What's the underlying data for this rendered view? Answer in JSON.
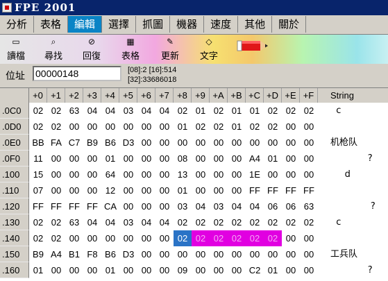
{
  "window": {
    "title": "FPE  2001"
  },
  "menu": [
    {
      "label": "分析",
      "active": false
    },
    {
      "label": "表格",
      "active": false
    },
    {
      "label": "編輯",
      "active": true
    },
    {
      "label": "選擇",
      "active": false
    },
    {
      "label": "抓圖",
      "active": false
    },
    {
      "label": "機器",
      "active": false
    },
    {
      "label": "速度",
      "active": false
    },
    {
      "label": "其他",
      "active": false
    },
    {
      "label": "關於",
      "active": false
    }
  ],
  "toolbar": {
    "buttons": [
      {
        "label": "讀檔",
        "icon": "open-folder-icon"
      },
      {
        "label": "尋找",
        "icon": "find-icon"
      },
      {
        "label": "回復",
        "icon": "undo-icon"
      },
      {
        "label": "表格",
        "icon": "table-icon"
      },
      {
        "label": "更新",
        "icon": "refresh-icon"
      },
      {
        "label": "文字",
        "icon": "text-icon"
      }
    ],
    "graphic": "pencil-icon"
  },
  "address": {
    "label": "位址",
    "value": "00000148",
    "info_line1": "[08]:2  [16]:514",
    "info_line2": "[32]:33686018"
  },
  "hex_grid": {
    "columns": [
      "+0",
      "+1",
      "+2",
      "+3",
      "+4",
      "+5",
      "+6",
      "+7",
      "+8",
      "+9",
      "+A",
      "+B",
      "+C",
      "+D",
      "+E",
      "+F"
    ],
    "string_header": "String",
    "rows": [
      {
        "addr": ".0C0",
        "bytes": [
          "02",
          "02",
          "63",
          "04",
          "04",
          "03",
          "04",
          "04",
          "02",
          "01",
          "02",
          "01",
          "01",
          "02",
          "02",
          "02"
        ],
        "text": "  c"
      },
      {
        "addr": ".0D0",
        "bytes": [
          "02",
          "02",
          "00",
          "00",
          "00",
          "00",
          "00",
          "00",
          "01",
          "02",
          "02",
          "01",
          "02",
          "02",
          "00",
          "00"
        ],
        "text": ""
      },
      {
        "addr": ".0E0",
        "bytes": [
          "BB",
          "FA",
          "C7",
          "B9",
          "B6",
          "D3",
          "00",
          "00",
          "00",
          "00",
          "00",
          "00",
          "00",
          "00",
          "00",
          "00"
        ],
        "text": "机枪队"
      },
      {
        "addr": ".0F0",
        "bytes": [
          "11",
          "00",
          "00",
          "00",
          "01",
          "00",
          "00",
          "00",
          "08",
          "00",
          "00",
          "00",
          "A4",
          "01",
          "00",
          "00"
        ],
        "text": "             ?"
      },
      {
        "addr": ".100",
        "bytes": [
          "15",
          "00",
          "00",
          "00",
          "64",
          "00",
          "00",
          "00",
          "13",
          "00",
          "00",
          "00",
          "1E",
          "00",
          "00",
          "00"
        ],
        "text": "     d"
      },
      {
        "addr": ".110",
        "bytes": [
          "07",
          "00",
          "00",
          "00",
          "12",
          "00",
          "00",
          "00",
          "01",
          "00",
          "00",
          "00",
          "FF",
          "FF",
          "FF",
          "FF"
        ],
        "text": ""
      },
      {
        "addr": ".120",
        "bytes": [
          "FF",
          "FF",
          "FF",
          "FF",
          "CA",
          "00",
          "00",
          "00",
          "03",
          "04",
          "03",
          "04",
          "04",
          "06",
          "06",
          "63"
        ],
        "text": "              ?"
      },
      {
        "addr": ".130",
        "bytes": [
          "02",
          "02",
          "63",
          "04",
          "04",
          "03",
          "04",
          "04",
          "02",
          "02",
          "02",
          "02",
          "02",
          "02",
          "02",
          "02"
        ],
        "text": "  c"
      },
      {
        "addr": ".140",
        "bytes": [
          "02",
          "02",
          "00",
          "00",
          "00",
          "00",
          "00",
          "00",
          "02",
          "02",
          "02",
          "02",
          "02",
          "02",
          "00",
          "00"
        ],
        "text": ""
      },
      {
        "addr": ".150",
        "bytes": [
          "B9",
          "A4",
          "B1",
          "F8",
          "B6",
          "D3",
          "00",
          "00",
          "00",
          "00",
          "00",
          "00",
          "00",
          "00",
          "00",
          "00"
        ],
        "text": "工兵队"
      },
      {
        "addr": ".160",
        "bytes": [
          "01",
          "00",
          "00",
          "00",
          "01",
          "00",
          "00",
          "00",
          "09",
          "00",
          "00",
          "00",
          "C2",
          "01",
          "00",
          "00"
        ],
        "text": "             ?"
      }
    ],
    "cursor": {
      "row": 8,
      "col": 8
    },
    "selection": {
      "row": 8,
      "from": 9,
      "to": 13
    }
  },
  "colors": {
    "title_bar": "#08246b",
    "active_menu": "#0a84c6",
    "cursor_cell": "#2a73c6",
    "selection": "#e100e1"
  }
}
